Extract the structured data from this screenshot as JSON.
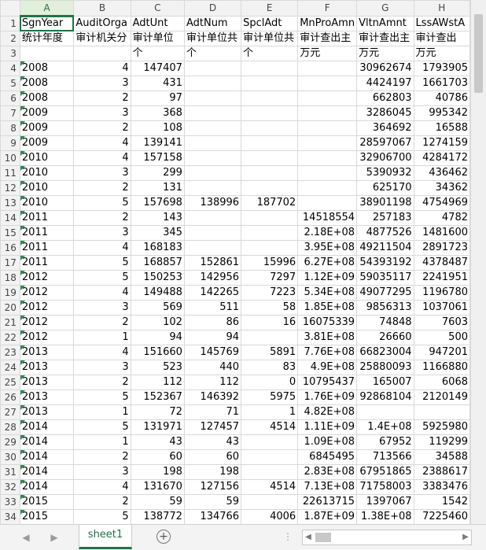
{
  "columns": [
    "A",
    "B",
    "C",
    "D",
    "E",
    "F",
    "G",
    "H"
  ],
  "active_column": "A",
  "rows": [
    {
      "n": "1",
      "cells": [
        "SgnYear",
        "AuditOrga",
        "AdtUnt",
        "AdtNum",
        "SpclAdt",
        "MnProAmn",
        "VltnAmnt",
        "LssAWstA"
      ]
    },
    {
      "n": "2",
      "cells": [
        "统计年度",
        "审计机关分",
        "审计单位",
        "审计单位共",
        "审计单位共",
        "审计查出主",
        "审计查出主",
        "审计查出"
      ]
    },
    {
      "n": "3",
      "cells": [
        "",
        "",
        "个",
        "个",
        "个",
        "万元",
        "万元",
        "万元"
      ]
    },
    {
      "n": "4",
      "cells": [
        "2008",
        "4",
        "147407",
        "",
        "",
        "",
        "30962674",
        "1793905"
      ]
    },
    {
      "n": "5",
      "cells": [
        "2008",
        "3",
        "431",
        "",
        "",
        "",
        "4424197",
        "1661703"
      ]
    },
    {
      "n": "6",
      "cells": [
        "2008",
        "2",
        "97",
        "",
        "",
        "",
        "662803",
        "40786"
      ]
    },
    {
      "n": "7",
      "cells": [
        "2009",
        "3",
        "368",
        "",
        "",
        "",
        "3286045",
        "995342"
      ]
    },
    {
      "n": "8",
      "cells": [
        "2009",
        "2",
        "108",
        "",
        "",
        "",
        "364692",
        "16588"
      ]
    },
    {
      "n": "9",
      "cells": [
        "2009",
        "4",
        "139141",
        "",
        "",
        "",
        "28597067",
        "1274159"
      ]
    },
    {
      "n": "10",
      "cells": [
        "2010",
        "4",
        "157158",
        "",
        "",
        "",
        "32906700",
        "4284172"
      ]
    },
    {
      "n": "11",
      "cells": [
        "2010",
        "3",
        "299",
        "",
        "",
        "",
        "5390932",
        "436462"
      ]
    },
    {
      "n": "12",
      "cells": [
        "2010",
        "2",
        "131",
        "",
        "",
        "",
        "625170",
        "34362"
      ]
    },
    {
      "n": "13",
      "cells": [
        "2010",
        "5",
        "157698",
        "138996",
        "187702",
        "",
        "38901198",
        "4754969"
      ]
    },
    {
      "n": "14",
      "cells": [
        "2011",
        "2",
        "143",
        "",
        "",
        "14518554",
        "257183",
        "4782"
      ]
    },
    {
      "n": "15",
      "cells": [
        "2011",
        "3",
        "345",
        "",
        "",
        "2.18E+08",
        "4877526",
        "1481600"
      ]
    },
    {
      "n": "16",
      "cells": [
        "2011",
        "4",
        "168183",
        "",
        "",
        "3.95E+08",
        "49211504",
        "2891723"
      ]
    },
    {
      "n": "17",
      "cells": [
        "2011",
        "5",
        "168857",
        "152861",
        "15996",
        "6.27E+08",
        "54393192",
        "4378487"
      ]
    },
    {
      "n": "18",
      "cells": [
        "2012",
        "5",
        "150253",
        "142956",
        "7297",
        "1.12E+09",
        "59035117",
        "2241951"
      ]
    },
    {
      "n": "19",
      "cells": [
        "2012",
        "4",
        "149488",
        "142265",
        "7223",
        "5.34E+08",
        "49077295",
        "1196780"
      ]
    },
    {
      "n": "20",
      "cells": [
        "2012",
        "3",
        "569",
        "511",
        "58",
        "1.85E+08",
        "9856313",
        "1037061"
      ]
    },
    {
      "n": "21",
      "cells": [
        "2012",
        "2",
        "102",
        "86",
        "16",
        "16075339",
        "74848",
        "7603"
      ]
    },
    {
      "n": "22",
      "cells": [
        "2012",
        "1",
        "94",
        "94",
        "",
        "3.81E+08",
        "26660",
        "500"
      ]
    },
    {
      "n": "23",
      "cells": [
        "2013",
        "4",
        "151660",
        "145769",
        "5891",
        "7.76E+08",
        "66823004",
        "947201"
      ]
    },
    {
      "n": "24",
      "cells": [
        "2013",
        "3",
        "523",
        "440",
        "83",
        "4.9E+08",
        "25880093",
        "1166880"
      ]
    },
    {
      "n": "25",
      "cells": [
        "2013",
        "2",
        "112",
        "112",
        "0",
        "10795437",
        "165007",
        "6068"
      ]
    },
    {
      "n": "26",
      "cells": [
        "2013",
        "5",
        "152367",
        "146392",
        "5975",
        "1.76E+09",
        "92868104",
        "2120149"
      ]
    },
    {
      "n": "27",
      "cells": [
        "2013",
        "1",
        "72",
        "71",
        "1",
        "4.82E+08",
        "",
        ""
      ]
    },
    {
      "n": "28",
      "cells": [
        "2014",
        "5",
        "131971",
        "127457",
        "4514",
        "1.11E+09",
        "1.4E+08",
        "5925980"
      ]
    },
    {
      "n": "29",
      "cells": [
        "2014",
        "1",
        "43",
        "43",
        "",
        "1.09E+08",
        "67952",
        "119299"
      ]
    },
    {
      "n": "30",
      "cells": [
        "2014",
        "2",
        "60",
        "60",
        "",
        "6845495",
        "713566",
        "34588"
      ]
    },
    {
      "n": "31",
      "cells": [
        "2014",
        "3",
        "198",
        "198",
        "",
        "2.83E+08",
        "67951865",
        "2388617"
      ]
    },
    {
      "n": "32",
      "cells": [
        "2014",
        "4",
        "131670",
        "127156",
        "4514",
        "7.13E+08",
        "71758003",
        "3383476"
      ]
    },
    {
      "n": "33",
      "cells": [
        "2015",
        "2",
        "59",
        "59",
        "",
        "22613715",
        "1397067",
        "1542"
      ]
    },
    {
      "n": "34",
      "cells": [
        "2015",
        "5",
        "138772",
        "134766",
        "4006",
        "1.87E+09",
        "1.38E+08",
        "7225460"
      ]
    }
  ],
  "sheet_tab_label": "sheet1",
  "add_sheet_symbol": "+",
  "nav_prev_symbol": "◀",
  "nav_next_symbol": "▶",
  "split_symbol": "⋮",
  "hscroll_left": "◀",
  "hscroll_right": "▶",
  "accent_color": "#217346"
}
